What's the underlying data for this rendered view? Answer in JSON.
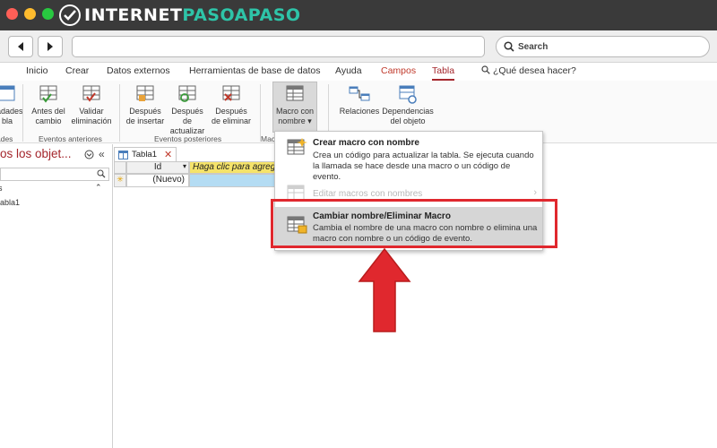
{
  "site": {
    "logo_main": "INTERNET",
    "logo_accent": "PASOAPASO"
  },
  "browser": {
    "search_placeholder": "Search"
  },
  "ribbon_tabs": [
    {
      "label": "Inicio"
    },
    {
      "label": "Crear"
    },
    {
      "label": "Datos externos"
    },
    {
      "label": "Herramientas de base de datos"
    },
    {
      "label": "Ayuda"
    },
    {
      "label": "Campos"
    },
    {
      "label": "Tabla"
    },
    {
      "label": "¿Qué desea hacer?"
    }
  ],
  "ribbon": {
    "clipped_btn_line1": "ladades",
    "clipped_btn_line2": "bla",
    "clipped_group": "ades",
    "btn_antes_cambio": [
      "Antes del",
      "cambio"
    ],
    "btn_validar": [
      "Validar",
      "eliminación"
    ],
    "group_eventos_anteriores": "Eventos anteriores",
    "btn_despues_insertar": [
      "Después",
      "de insertar"
    ],
    "btn_despues_actualizar": [
      "Después de",
      "actualizar"
    ],
    "btn_despues_eliminar": [
      "Después",
      "de eliminar"
    ],
    "group_eventos_posteriores": "Eventos posteriores",
    "btn_macro": [
      "Macro con",
      "nombre"
    ],
    "group_macro_clipped": "Mac",
    "btn_relaciones": "Relaciones",
    "btn_dependencias": [
      "Dependencias",
      "del objeto"
    ]
  },
  "nav_pane": {
    "title": "os los objet...",
    "collapse_glyph": "«",
    "dropdown_glyph": "⌄",
    "section_glyph": "s",
    "section_toggle": "⌃",
    "item": "abla1"
  },
  "document": {
    "tab_label": "Tabla1",
    "col_id": "Id",
    "col_new": "Haga clic para agreg",
    "row_value": "(Nuevo)",
    "row_marker": "✳"
  },
  "menu": {
    "items": [
      {
        "title": "Crear macro con nombre",
        "desc": "Crea un código para actualizar la tabla. Se ejecuta cuando la llamada se hace desde una macro o un código de evento."
      },
      {
        "title": "Editar macros con nombres",
        "desc": ""
      },
      {
        "title": "Cambiar nombre/Eliminar Macro",
        "desc": "Cambia el nombre de una macro con nombre o elimina una macro con nombre o un código de evento."
      }
    ]
  },
  "colors": {
    "accent": "#a4262c",
    "highlight_box": "#e0282e",
    "logo_accent": "#2ec4a8"
  }
}
